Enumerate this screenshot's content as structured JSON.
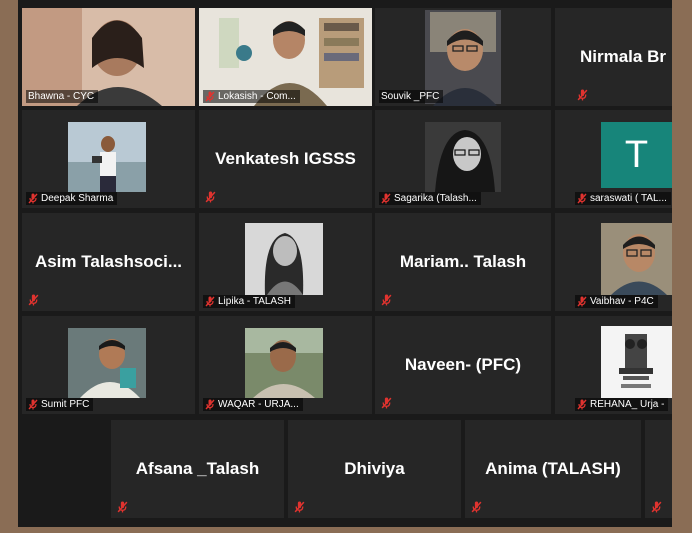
{
  "participants": [
    {
      "id": "bhawna",
      "label": "Bhawna - CYC"
    },
    {
      "id": "lokasish",
      "label": "Lokasish - Com..."
    },
    {
      "id": "souvik",
      "label": "Souvik _PFC"
    },
    {
      "id": "nirmala",
      "name": "Nirmala  Br"
    },
    {
      "id": "deepak",
      "label": "Deepak Sharma"
    },
    {
      "id": "venkatesh",
      "name": "Venkatesh IGSSS"
    },
    {
      "id": "sagarika",
      "label": "Sagarika (Talash..."
    },
    {
      "id": "saraswati",
      "label": "saraswati ( TAL...",
      "avatar_letter": "T"
    },
    {
      "id": "asim",
      "name": "Asim  Talashsoci..."
    },
    {
      "id": "lipika",
      "label": "Lipika - TALASH"
    },
    {
      "id": "mariam",
      "name": "Mariam.. Talash"
    },
    {
      "id": "vaibhav",
      "label": "Vaibhav - P4C"
    },
    {
      "id": "sumit",
      "label": "Sumit PFC"
    },
    {
      "id": "waqar",
      "label": "WAQAR - URJA..."
    },
    {
      "id": "naveen",
      "name": "Naveen- (PFC)"
    },
    {
      "id": "rehana",
      "label": "REHANA_ Urja -"
    },
    {
      "id": "afsana",
      "name": "Afsana _Talash"
    },
    {
      "id": "dhiviya",
      "name": "Dhiviya"
    },
    {
      "id": "anima",
      "name": "Anima (TALASH)"
    }
  ],
  "colors": {
    "active_speaker_border": "#c9e36b",
    "muted_icon": "#e0332f",
    "tile_bg": "#262626"
  },
  "icons": {
    "muted": "microphone-muted-icon"
  }
}
